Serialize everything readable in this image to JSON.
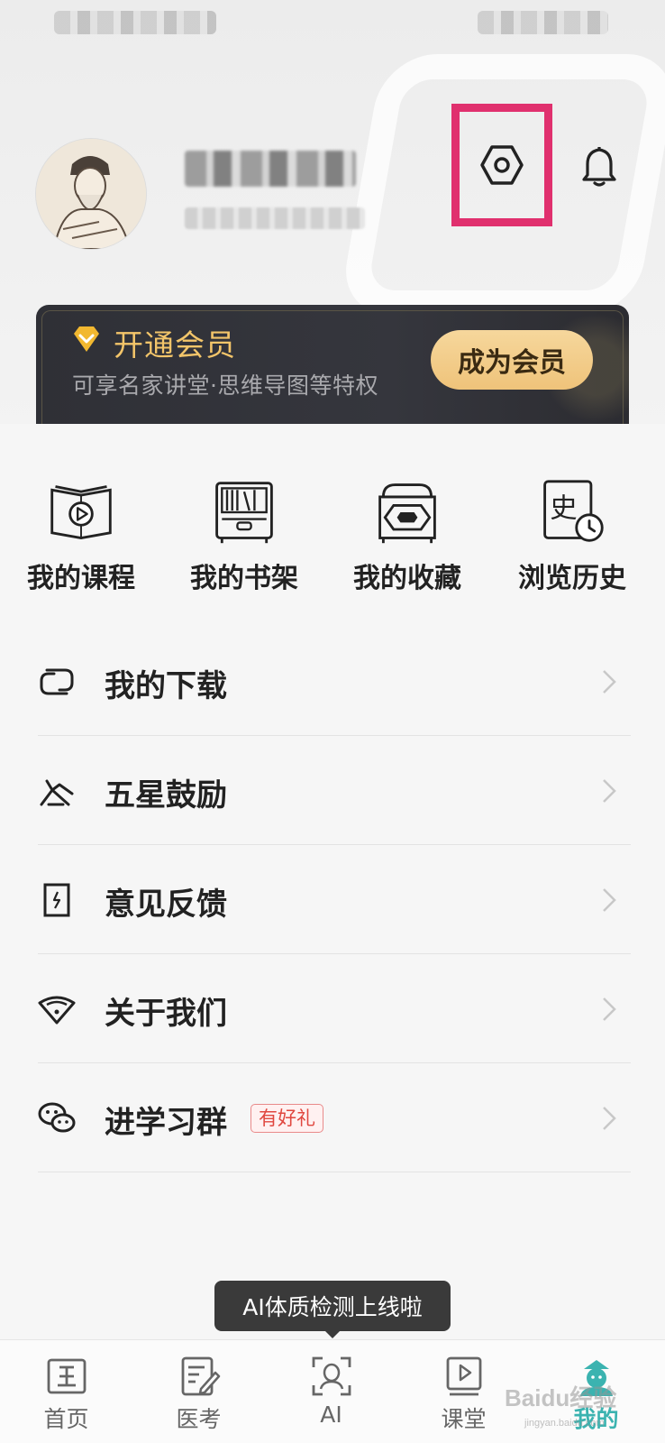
{
  "header": {
    "settings_icon": "hexagon-settings-icon",
    "bell_icon": "bell-icon",
    "highlight_color": "#e0306e"
  },
  "vip": {
    "title": "开通会员",
    "subtitle": "可享名家讲堂·思维导图等特权",
    "button": "成为会员",
    "accent_color": "#f3c56a"
  },
  "quick_links": [
    {
      "label": "我的课程",
      "icon": "book-play-icon"
    },
    {
      "label": "我的书架",
      "icon": "bookshelf-icon"
    },
    {
      "label": "我的收藏",
      "icon": "treasure-box-icon"
    },
    {
      "label": "浏览历史",
      "icon": "history-book-clock-icon"
    }
  ],
  "menu": [
    {
      "label": "我的下载",
      "icon": "download-icon"
    },
    {
      "label": "五星鼓励",
      "icon": "five-star-icon"
    },
    {
      "label": "意见反馈",
      "icon": "feedback-icon"
    },
    {
      "label": "关于我们",
      "icon": "fan-icon"
    },
    {
      "label": "进学习群",
      "icon": "wechat-icon",
      "badge": "有好礼"
    }
  ],
  "tooltip": "AI体质检测上线啦",
  "tabs": [
    {
      "label": "首页",
      "icon": "home-icon",
      "active": false
    },
    {
      "label": "医考",
      "icon": "exam-icon",
      "active": false
    },
    {
      "label": "AI",
      "icon": "ai-scan-icon",
      "active": false
    },
    {
      "label": "课堂",
      "icon": "classroom-icon",
      "active": false
    },
    {
      "label": "我的",
      "icon": "profile-icon",
      "active": true
    }
  ],
  "watermark": {
    "text": "Baidu经验",
    "sub": "jingyan.baidu.com"
  }
}
